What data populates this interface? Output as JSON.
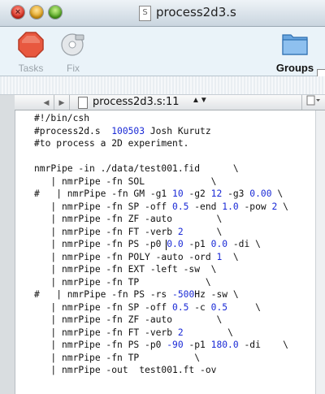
{
  "window": {
    "title": "process2d3.s",
    "doc_icon_glyph": "S"
  },
  "toolbar": {
    "tasks_label": "Tasks",
    "fix_label": "Fix",
    "groups_label": "Groups"
  },
  "navbar": {
    "back_glyph": "◀",
    "forward_glyph": "▶",
    "file_label": "process2d3.s:11",
    "arrows_glyph": "▲▼"
  },
  "colors": {
    "number": "#1a2ad6",
    "text": "#111111"
  },
  "code_lines": [
    [
      [
        "t",
        "#!/bin/csh"
      ]
    ],
    [
      [
        "t",
        "#process2d.s  "
      ],
      [
        "n",
        "100503"
      ],
      [
        "t",
        " Josh Kurutz"
      ]
    ],
    [
      [
        "t",
        "#to process a 2D experiment."
      ]
    ],
    [
      [
        "t",
        ""
      ]
    ],
    [
      [
        "t",
        "nmrPipe -in ./data/test001.fid      \\"
      ]
    ],
    [
      [
        "t",
        "   | nmrPipe -fn SOL            \\"
      ]
    ],
    [
      [
        "t",
        "#   | nmrPipe -fn GM -g1 "
      ],
      [
        "n",
        "10"
      ],
      [
        "t",
        " -g2 "
      ],
      [
        "n",
        "12"
      ],
      [
        "t",
        " -g3 "
      ],
      [
        "n",
        "0.00"
      ],
      [
        "t",
        " \\"
      ]
    ],
    [
      [
        "t",
        "   | nmrPipe -fn SP -off "
      ],
      [
        "n",
        "0.5"
      ],
      [
        "t",
        " -end "
      ],
      [
        "n",
        "1.0"
      ],
      [
        "t",
        " -pow "
      ],
      [
        "n",
        "2"
      ],
      [
        "t",
        " \\"
      ]
    ],
    [
      [
        "t",
        "   | nmrPipe -fn ZF -auto        \\"
      ]
    ],
    [
      [
        "t",
        "   | nmrPipe -fn FT -verb "
      ],
      [
        "n",
        "2"
      ],
      [
        "t",
        "      \\"
      ]
    ],
    [
      [
        "t",
        "   | nmrPipe -fn PS -p0 "
      ],
      [
        "c",
        ""
      ],
      [
        "n",
        "0.0"
      ],
      [
        "t",
        " -p1 "
      ],
      [
        "n",
        "0.0"
      ],
      [
        "t",
        " -di \\"
      ]
    ],
    [
      [
        "t",
        "   | nmrPipe -fn POLY -auto -ord "
      ],
      [
        "n",
        "1"
      ],
      [
        "t",
        "  \\"
      ]
    ],
    [
      [
        "t",
        "   | nmrPipe -fn EXT -left -sw  \\"
      ]
    ],
    [
      [
        "t",
        "   | nmrPipe -fn TP            \\"
      ]
    ],
    [
      [
        "t",
        "#   | nmrPipe -fn PS -rs "
      ],
      [
        "n",
        "-500"
      ],
      [
        "t",
        "Hz -sw \\"
      ]
    ],
    [
      [
        "t",
        "   | nmrPipe -fn SP -off "
      ],
      [
        "n",
        "0.5"
      ],
      [
        "t",
        " -c "
      ],
      [
        "n",
        "0.5"
      ],
      [
        "t",
        "     \\"
      ]
    ],
    [
      [
        "t",
        "   | nmrPipe -fn ZF -auto        \\"
      ]
    ],
    [
      [
        "t",
        "   | nmrPipe -fn FT -verb "
      ],
      [
        "n",
        "2"
      ],
      [
        "t",
        "        \\"
      ]
    ],
    [
      [
        "t",
        "   | nmrPipe -fn PS -p0 "
      ],
      [
        "n",
        "-90"
      ],
      [
        "t",
        " -p1 "
      ],
      [
        "n",
        "180.0"
      ],
      [
        "t",
        " -di    \\"
      ]
    ],
    [
      [
        "t",
        "   | nmrPipe -fn TP          \\"
      ]
    ],
    [
      [
        "t",
        "   | nmrPipe -out  test001.ft -ov"
      ]
    ]
  ]
}
